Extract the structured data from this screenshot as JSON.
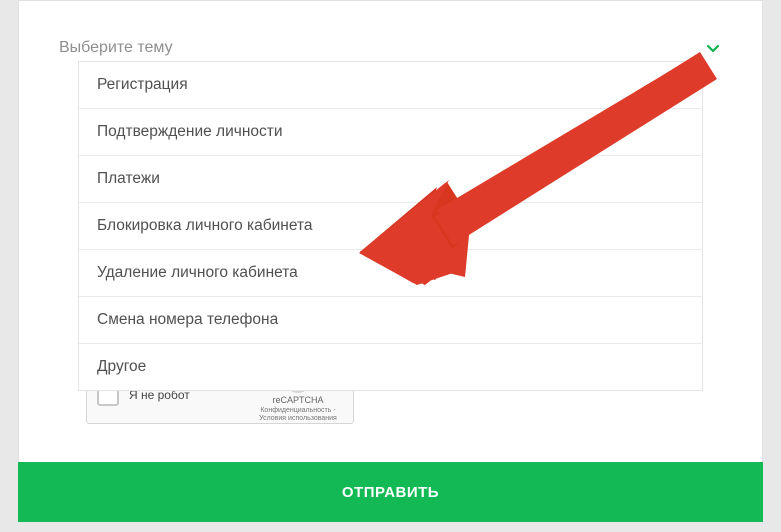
{
  "select": {
    "placeholder": "Выберите тему",
    "options": [
      "Регистрация",
      "Подтверждение личности",
      "Платежи",
      "Блокировка личного кабинета",
      "Удаление личного кабинета",
      "Смена номера телефона",
      "Другое"
    ]
  },
  "recaptcha": {
    "label": "Я не робот",
    "brand": "reCAPTCHA",
    "legal": "Конфиденциальность - Условия использования"
  },
  "submit_label": "ОТПРАВИТЬ",
  "colors": {
    "accent": "#12b955",
    "arrow": "#de3b2a"
  }
}
